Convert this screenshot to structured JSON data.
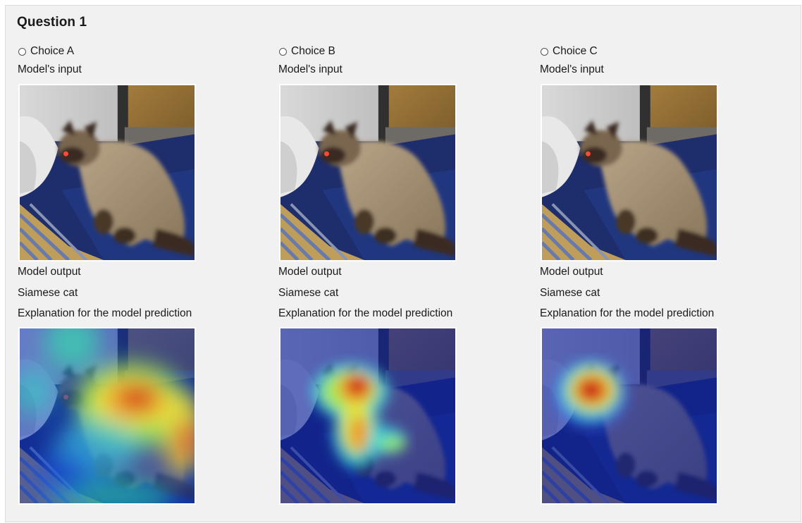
{
  "question": {
    "title": "Question 1"
  },
  "choices": [
    {
      "label": "Choice A",
      "input_label": "Model's input",
      "output_label": "Model output",
      "prediction": "Siamese cat",
      "explanation_label": "Explanation for the model prediction",
      "heatmap": "broad-chest-and-back"
    },
    {
      "label": "Choice B",
      "input_label": "Model's input",
      "output_label": "Model output",
      "prediction": "Siamese cat",
      "explanation_label": "Explanation for the model prediction",
      "heatmap": "head-and-body-outline"
    },
    {
      "label": "Choice C",
      "input_label": "Model's input",
      "output_label": "Model output",
      "prediction": "Siamese cat",
      "explanation_label": "Explanation for the model prediction",
      "heatmap": "head-focused"
    }
  ]
}
